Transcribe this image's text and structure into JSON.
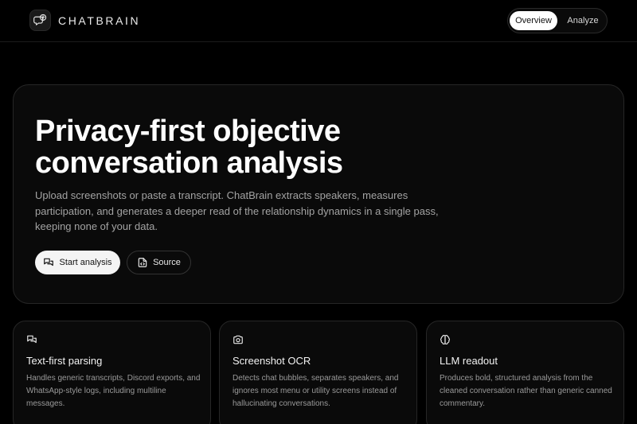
{
  "header": {
    "brand_icon": "chat-bubble-brain-icon",
    "brand_name": "CHATBRAIN",
    "nav": [
      {
        "label": "Overview",
        "active": true
      },
      {
        "label": "Analyze",
        "active": false
      }
    ]
  },
  "hero": {
    "title": "Privacy-first objective conversation analysis",
    "description": "Upload screenshots or paste a transcript. ChatBrain extracts speakers, measures participation, and generates a deeper read of the relationship dynamics in a single pass, keeping none of your data.",
    "primary_button": {
      "label": "Start analysis",
      "icon": "chat-bubbles-icon"
    },
    "secondary_button": {
      "label": "Source",
      "icon": "code-file-icon"
    }
  },
  "features": [
    {
      "icon": "chat-bubbles-icon",
      "title": "Text-first parsing",
      "description": "Handles generic transcripts, Discord exports, and WhatsApp-style logs, including multiline messages."
    },
    {
      "icon": "camera-icon",
      "title": "Screenshot OCR",
      "description": "Detects chat bubbles, separates speakers, and ignores most menu or utility screens instead of hallucinating conversations."
    },
    {
      "icon": "brain-icon",
      "title": "LLM readout",
      "description": "Produces bold, structured analysis from the cleaned conversation rather than generic canned commentary."
    }
  ],
  "colors": {
    "background": "#000000",
    "card": "#0a0a0a",
    "border": "#262626",
    "text_primary": "#ffffff",
    "text_muted": "#a3a3a3",
    "button_light": "#f4f4f4"
  }
}
